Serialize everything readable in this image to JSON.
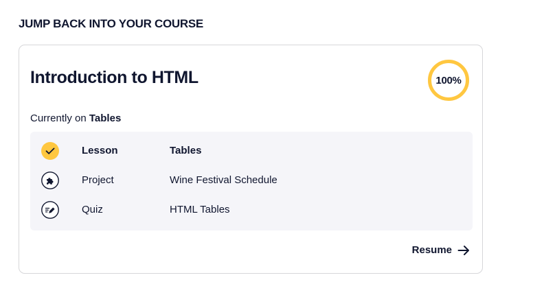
{
  "section": {
    "heading": "JUMP BACK INTO YOUR COURSE"
  },
  "course": {
    "title": "Introduction to HTML",
    "progress_label": "100%",
    "progress_fraction": 1.0,
    "currently_prefix": "Currently on",
    "currently_item": "Tables",
    "items": [
      {
        "type": "Lesson",
        "name": "Tables",
        "icon": "checkmark-icon",
        "status": "current"
      },
      {
        "type": "Project",
        "name": "Wine Festival Schedule",
        "icon": "puzzle-icon",
        "status": "upcoming"
      },
      {
        "type": "Quiz",
        "name": "HTML Tables",
        "icon": "quiz-pencil-icon",
        "status": "upcoming"
      }
    ],
    "resume_label": "Resume"
  },
  "colors": {
    "accent": "#ffc740",
    "text": "#10162f",
    "panel": "#f5f5f9",
    "border": "#d6d6d9"
  }
}
